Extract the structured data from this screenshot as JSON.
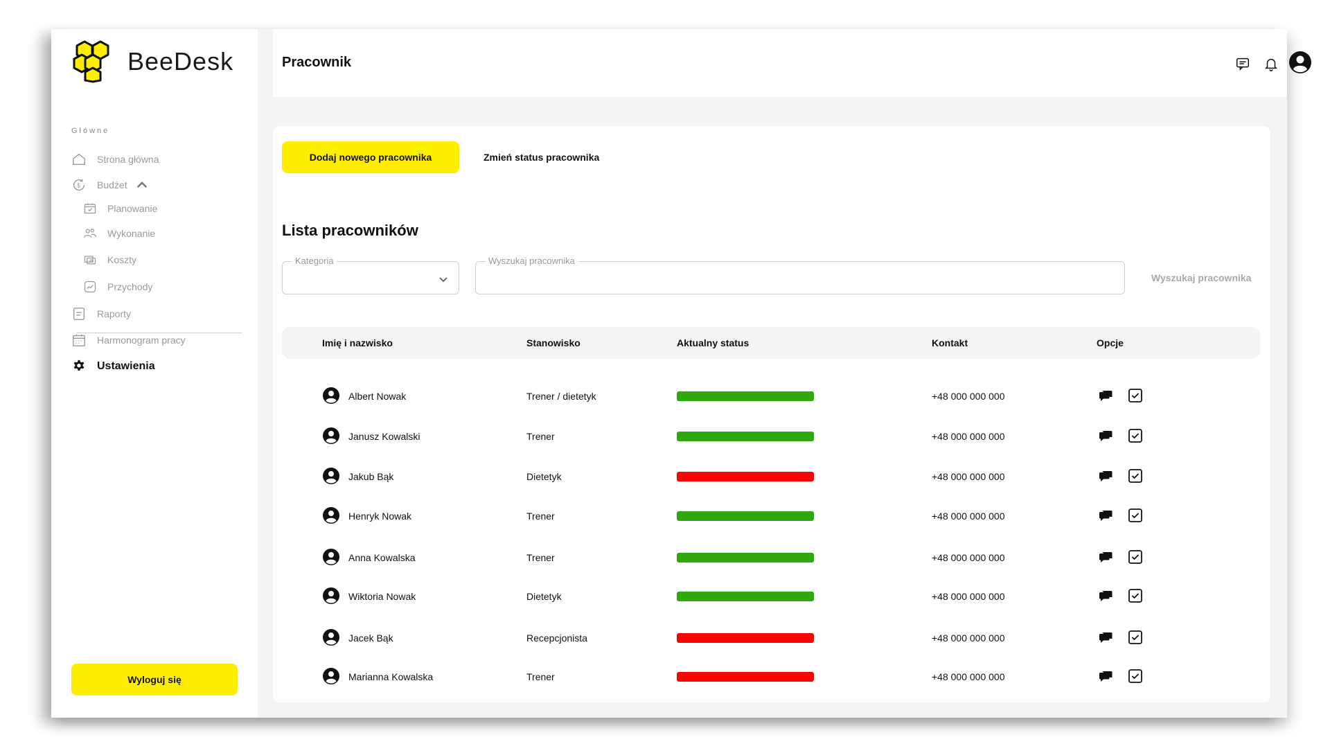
{
  "brand": {
    "name": "BeeDesk",
    "accent": "#ffee00",
    "logo_icon": "honeycomb-icon"
  },
  "sidebar": {
    "section_label": "Główne",
    "items": [
      {
        "label": "Strona główna",
        "icon": "home-icon"
      },
      {
        "label": "Budżet",
        "icon": "budget-icon",
        "expanded": true
      },
      {
        "label": "Planowanie",
        "icon": "calendar-check-icon",
        "sub": true
      },
      {
        "label": "Wykonanie",
        "icon": "people-icon",
        "sub": true
      },
      {
        "label": "Koszty",
        "icon": "cash-icon",
        "sub": true
      },
      {
        "label": "Przychody",
        "icon": "trend-icon",
        "sub": true
      },
      {
        "label": "Raporty",
        "icon": "report-icon"
      },
      {
        "label": "Harmonogram pracy",
        "icon": "schedule-icon"
      },
      {
        "label": "Ustawienia",
        "icon": "gear-icon",
        "active": true
      }
    ],
    "logout_label": "Wyloguj się"
  },
  "header": {
    "title": "Pracownik",
    "icons": [
      "message-icon",
      "bell-icon",
      "user-icon"
    ]
  },
  "actions": {
    "add_label": "Dodaj nowego pracownika",
    "change_status_label": "Zmień status pracownika"
  },
  "list": {
    "title": "Lista pracowników",
    "category_label": "Kategoria",
    "category_value": "",
    "search_label": "Wyszukaj pracownika",
    "search_value": "",
    "search_button": "Wyszukaj pracownika"
  },
  "table": {
    "columns": [
      "Imię i nazwisko",
      "Stanowisko",
      "Aktualny status",
      "Kontakt",
      "Opcje"
    ],
    "status_colors": {
      "active": "#2ea80c",
      "inactive": "#ff0000"
    },
    "rows": [
      {
        "name": "Albert Nowak",
        "position": "Trener / dietetyk",
        "status": "active",
        "contact": "+48 000 000 000"
      },
      {
        "name": "Janusz Kowalski",
        "position": "Trener",
        "status": "active",
        "contact": "+48 000 000 000"
      },
      {
        "name": "Jakub Bąk",
        "position": "Dietetyk",
        "status": "inactive",
        "contact": "+48 000 000 000"
      },
      {
        "name": "Henryk Nowak",
        "position": "Trener",
        "status": "active",
        "contact": "+48 000 000 000"
      },
      {
        "name": "Anna Kowalska",
        "position": "Trener",
        "status": "active",
        "contact": "+48 000 000 000"
      },
      {
        "name": "Wiktoria Nowak",
        "position": "Dietetyk",
        "status": "active",
        "contact": "+48 000 000 000"
      },
      {
        "name": "Jacek Bąk",
        "position": "Recepcjonista",
        "status": "inactive",
        "contact": "+48 000 000 000"
      },
      {
        "name": "Marianna Kowalska",
        "position": "Trener",
        "status": "inactive",
        "contact": "+48 000 000 000"
      }
    ]
  }
}
